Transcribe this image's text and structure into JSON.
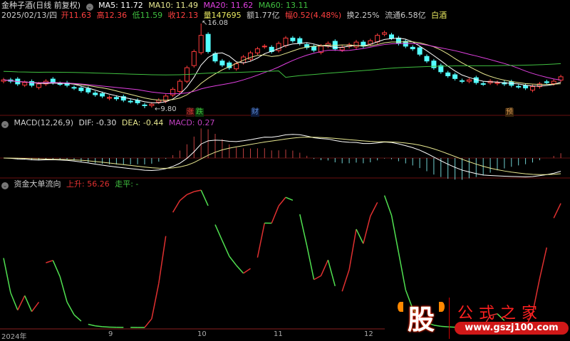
{
  "header": {
    "stock_name": "金种子酒(日线 前复权)",
    "ma5": "MA5: 11.72",
    "ma10": "MA10: 11.49",
    "ma20": "MA20: 11.62",
    "ma60": "MA60: 13.11",
    "date": "2025/02/13/四",
    "open": "开11.63",
    "high": "高12.36",
    "low": "低11.59",
    "close": "收12.13",
    "volume": "量147695",
    "amount": "额1.77亿",
    "change": "幅0.52(4.48%)",
    "turnover": "换2.25%",
    "float": "流通6.58亿",
    "sector": "白酒"
  },
  "main_chart": {
    "high_label": "16.08",
    "low_label": "9.80",
    "markers": [
      {
        "text": "涨",
        "color": "#e0403a"
      },
      {
        "text": "跌",
        "color": "#40c040"
      },
      {
        "text": "财",
        "color": "#5a8ad8"
      },
      {
        "text": "预",
        "color": "#d89a50"
      }
    ]
  },
  "macd_panel": {
    "title": "MACD(12,26,9)",
    "dif": "DIF: -0.30",
    "dea": "DEA: -0.44",
    "macd": "MACD: 0.27"
  },
  "flow_panel": {
    "title": "资金大单流向",
    "up": "上升: 56.26",
    "flat": "走平: -"
  },
  "x_axis": {
    "labels": [
      "2024年",
      "9",
      "10",
      "11",
      "12"
    ]
  },
  "logo": {
    "char": "股",
    "name": "公式之家",
    "url": "www.gszj100.com"
  },
  "colors": {
    "up": "#ff3c3c",
    "down": "#54ffff",
    "ma5": "#ffffff",
    "ma10": "#e8e890",
    "ma20": "#e040e0",
    "ma60": "#40c040"
  },
  "chart_data": {
    "type": "candlestick",
    "closes": [
      11.9,
      11.8,
      11.6,
      11.7,
      11.5,
      11.6,
      11.8,
      11.7,
      11.6,
      11.5,
      11.3,
      11.1,
      11.0,
      10.8,
      10.7,
      10.6,
      10.5,
      10.4,
      10.3,
      10.2,
      10.0,
      10.1,
      10.4,
      10.7,
      11.2,
      11.8,
      12.8,
      14.0,
      15.2,
      14.0,
      13.3,
      13.0,
      12.8,
      13.1,
      13.6,
      13.9,
      14.2,
      14.4,
      14.0,
      14.6,
      15.0,
      14.8,
      14.6,
      14.3,
      14.1,
      14.4,
      14.6,
      14.2,
      14.3,
      14.5,
      14.7,
      14.4,
      14.8,
      15.2,
      15.4,
      15.0,
      14.6,
      14.4,
      14.2,
      13.8,
      13.3,
      12.8,
      12.5,
      12.2,
      12.0,
      11.8,
      11.9,
      11.7,
      11.6,
      11.8,
      11.7,
      11.6,
      11.5,
      11.4,
      11.3,
      11.4,
      11.6,
      11.7,
      11.8,
      12.13
    ],
    "price_range": [
      9.8,
      16.08
    ]
  }
}
